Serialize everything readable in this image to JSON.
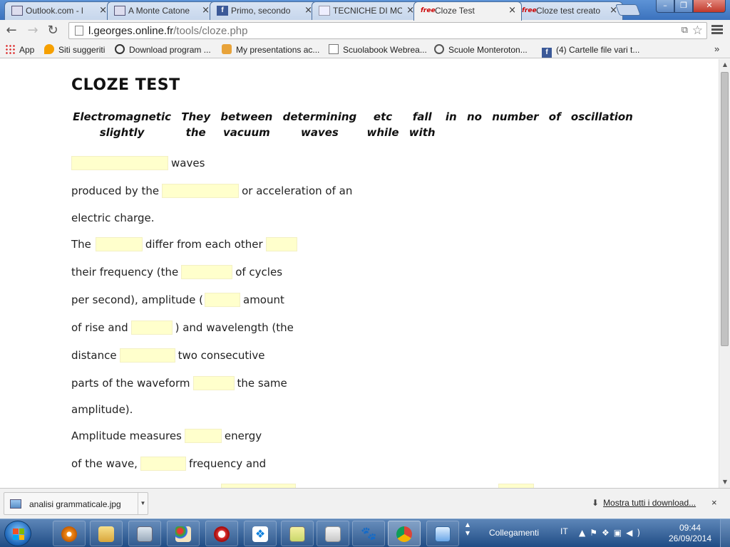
{
  "browser": {
    "tabs": [
      {
        "label": "Outlook.com - l",
        "favicon": "mail-icon"
      },
      {
        "label": "A Monte Catone",
        "favicon": "mail-icon"
      },
      {
        "label": "Primo, secondo",
        "favicon": "facebook-icon"
      },
      {
        "label": "TECNICHE DI MO",
        "favicon": "document-icon"
      },
      {
        "label": "Cloze Test",
        "favicon": "free-icon",
        "active": true
      },
      {
        "label": "Cloze test creato",
        "favicon": "free-icon"
      }
    ],
    "favicon_text": {
      "facebook": "f",
      "free": "free"
    },
    "close_glyph": "×",
    "url_domain": "l.georges.online.fr",
    "url_path": "/tools/cloze.php",
    "bookmarks": [
      {
        "label": "App",
        "icon": "apps-icon"
      },
      {
        "label": "Siti suggeriti",
        "icon": "pin-icon"
      },
      {
        "label": "Download program ...",
        "icon": "download-icon"
      },
      {
        "label": "My presentations ac...",
        "icon": "presentation-icon"
      },
      {
        "label": "Scuolabook Webrea...",
        "icon": "page-icon"
      },
      {
        "label": "Scuole Monteroton...",
        "icon": "radio-icon"
      },
      {
        "label": "(4) Cartelle file vari t...",
        "icon": "facebook-icon"
      }
    ],
    "bookmarks_more": "»"
  },
  "page": {
    "title": "CLOZE TEST",
    "word_bank": [
      "Electromagnetic",
      "They",
      "between",
      "determining",
      "etc",
      "fall",
      "in",
      "no",
      "number",
      "of",
      "oscillation",
      "slightly",
      "the",
      "vacuum",
      "waves",
      "while",
      "with"
    ],
    "lines": [
      {
        "before": "",
        "after": "waves"
      },
      {
        "before": "produced by the",
        "after": "or acceleration of an"
      },
      {
        "text": "electric charge."
      },
      {
        "before": "The",
        "middle": "differ from each other",
        "after": ""
      },
      {
        "before": "their frequency (the",
        "after": "of cycles"
      },
      {
        "before": "per second), amplitude (",
        "after": "amount"
      },
      {
        "before": "of rise and",
        "after": ") and wavelength (the"
      },
      {
        "before": "distance",
        "after": "two consecutive"
      },
      {
        "before": "parts of the waveform",
        "after": "the same"
      },
      {
        "text": "amplitude)."
      },
      {
        "before": "Amplitude measures",
        "after": "energy"
      },
      {
        "before": "of the wave,",
        "after": "frequency and"
      }
    ]
  },
  "downloads": {
    "file_name": "analisi grammaticale.jpg",
    "show_all": "Mostra tutti i download...",
    "close_glyph": "×"
  },
  "taskbar": {
    "toolbar_label": "Collegamenti",
    "language": "IT",
    "time": "09:44",
    "date": "26/09/2014"
  },
  "colors": {
    "gap_fill": "#ffffcc",
    "titlebar": "#3b72bd",
    "taskbar": "#1f4c85"
  }
}
